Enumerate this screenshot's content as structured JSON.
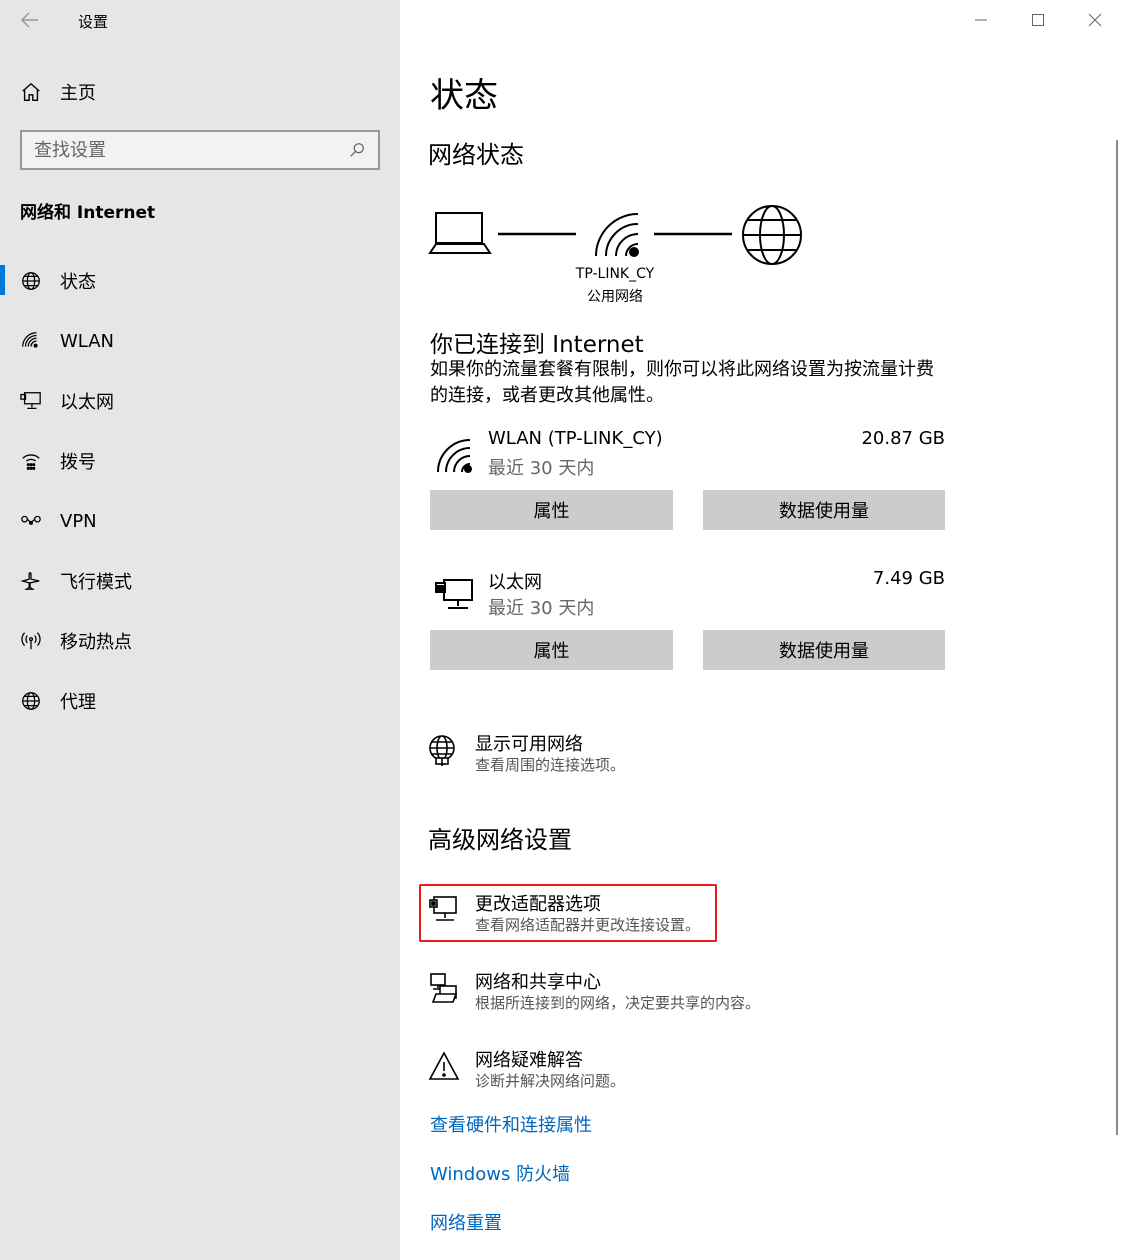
{
  "window": {
    "title": "设置"
  },
  "sidebar": {
    "home_label": "主页",
    "search_placeholder": "查找设置",
    "section_title": "网络和 Internet",
    "items": [
      {
        "label": "状态",
        "icon": "globe-icon",
        "active": true
      },
      {
        "label": "WLAN",
        "icon": "wifi-icon"
      },
      {
        "label": "以太网",
        "icon": "ethernet-icon"
      },
      {
        "label": "拨号",
        "icon": "dialup-icon"
      },
      {
        "label": "VPN",
        "icon": "vpn-icon"
      },
      {
        "label": "飞行模式",
        "icon": "airplane-icon"
      },
      {
        "label": "移动热点",
        "icon": "hotspot-icon"
      },
      {
        "label": "代理",
        "icon": "globe-icon"
      }
    ]
  },
  "main": {
    "title": "状态",
    "network_status_heading": "网络状态",
    "diagram": {
      "network_name": "TP-LINK_CY",
      "network_type": "公用网络"
    },
    "connected_title": "你已连接到 Internet",
    "connected_desc": "如果你的流量套餐有限制，则你可以将此网络设置为按流量计费的连接，或者更改其他属性。",
    "connections": [
      {
        "name": "WLAN (TP-LINK_CY)",
        "sub": "最近 30 天内",
        "size": "20.87 GB",
        "icon": "wifi-icon",
        "btn_properties": "属性",
        "btn_usage": "数据使用量"
      },
      {
        "name": "以太网",
        "sub": "最近 30 天内",
        "size": "7.49 GB",
        "icon": "ethernet-icon",
        "btn_properties": "属性",
        "btn_usage": "数据使用量"
      }
    ],
    "show_networks": {
      "title": "显示可用网络",
      "sub": "查看周围的连接选项。"
    },
    "advanced_heading": "高级网络设置",
    "advanced_items": [
      {
        "title": "更改适配器选项",
        "sub": "查看网络适配器并更改连接设置。",
        "icon": "adapter-icon",
        "highlighted": true
      },
      {
        "title": "网络和共享中心",
        "sub": "根据所连接到的网络，决定要共享的内容。",
        "icon": "sharing-center-icon"
      },
      {
        "title": "网络疑难解答",
        "sub": "诊断并解决网络问题。",
        "icon": "warning-icon"
      }
    ],
    "links": [
      "查看硬件和连接属性",
      "Windows 防火墙",
      "网络重置"
    ]
  },
  "colors": {
    "accent": "#0078d7",
    "link": "#0067c0",
    "highlight_border": "#e8191d",
    "sidebar_bg": "#e6e6e6",
    "button_bg": "#cccccc"
  }
}
